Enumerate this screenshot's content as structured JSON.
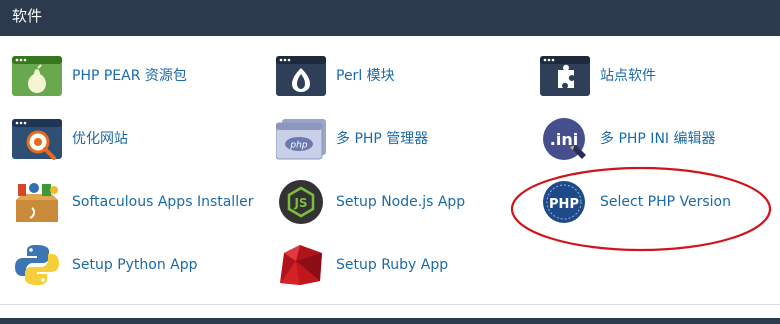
{
  "header": {
    "title": "软件"
  },
  "items": [
    {
      "label": "PHP PEAR 资源包",
      "icon": "pear-icon"
    },
    {
      "label": "Perl 模块",
      "icon": "perl-onion-icon"
    },
    {
      "label": "站点软件",
      "icon": "puzzle-icon"
    },
    {
      "label": "优化网站",
      "icon": "magnifier-icon"
    },
    {
      "label": "多 PHP 管理器",
      "icon": "php-manager-icon"
    },
    {
      "label": "多 PHP INI 编辑器",
      "icon": "php-ini-icon"
    },
    {
      "label": "Softaculous Apps Installer",
      "icon": "softaculous-box-icon"
    },
    {
      "label": "Setup Node.js App",
      "icon": "nodejs-icon"
    },
    {
      "label": "Select PHP Version",
      "icon": "php-version-icon"
    },
    {
      "label": "Setup Python App",
      "icon": "python-icon"
    },
    {
      "label": "Setup Ruby App",
      "icon": "ruby-icon"
    }
  ],
  "colors": {
    "header_bg": "#2b3a4d",
    "link": "#1b6aa8",
    "highlight_ring": "#d0141b"
  }
}
